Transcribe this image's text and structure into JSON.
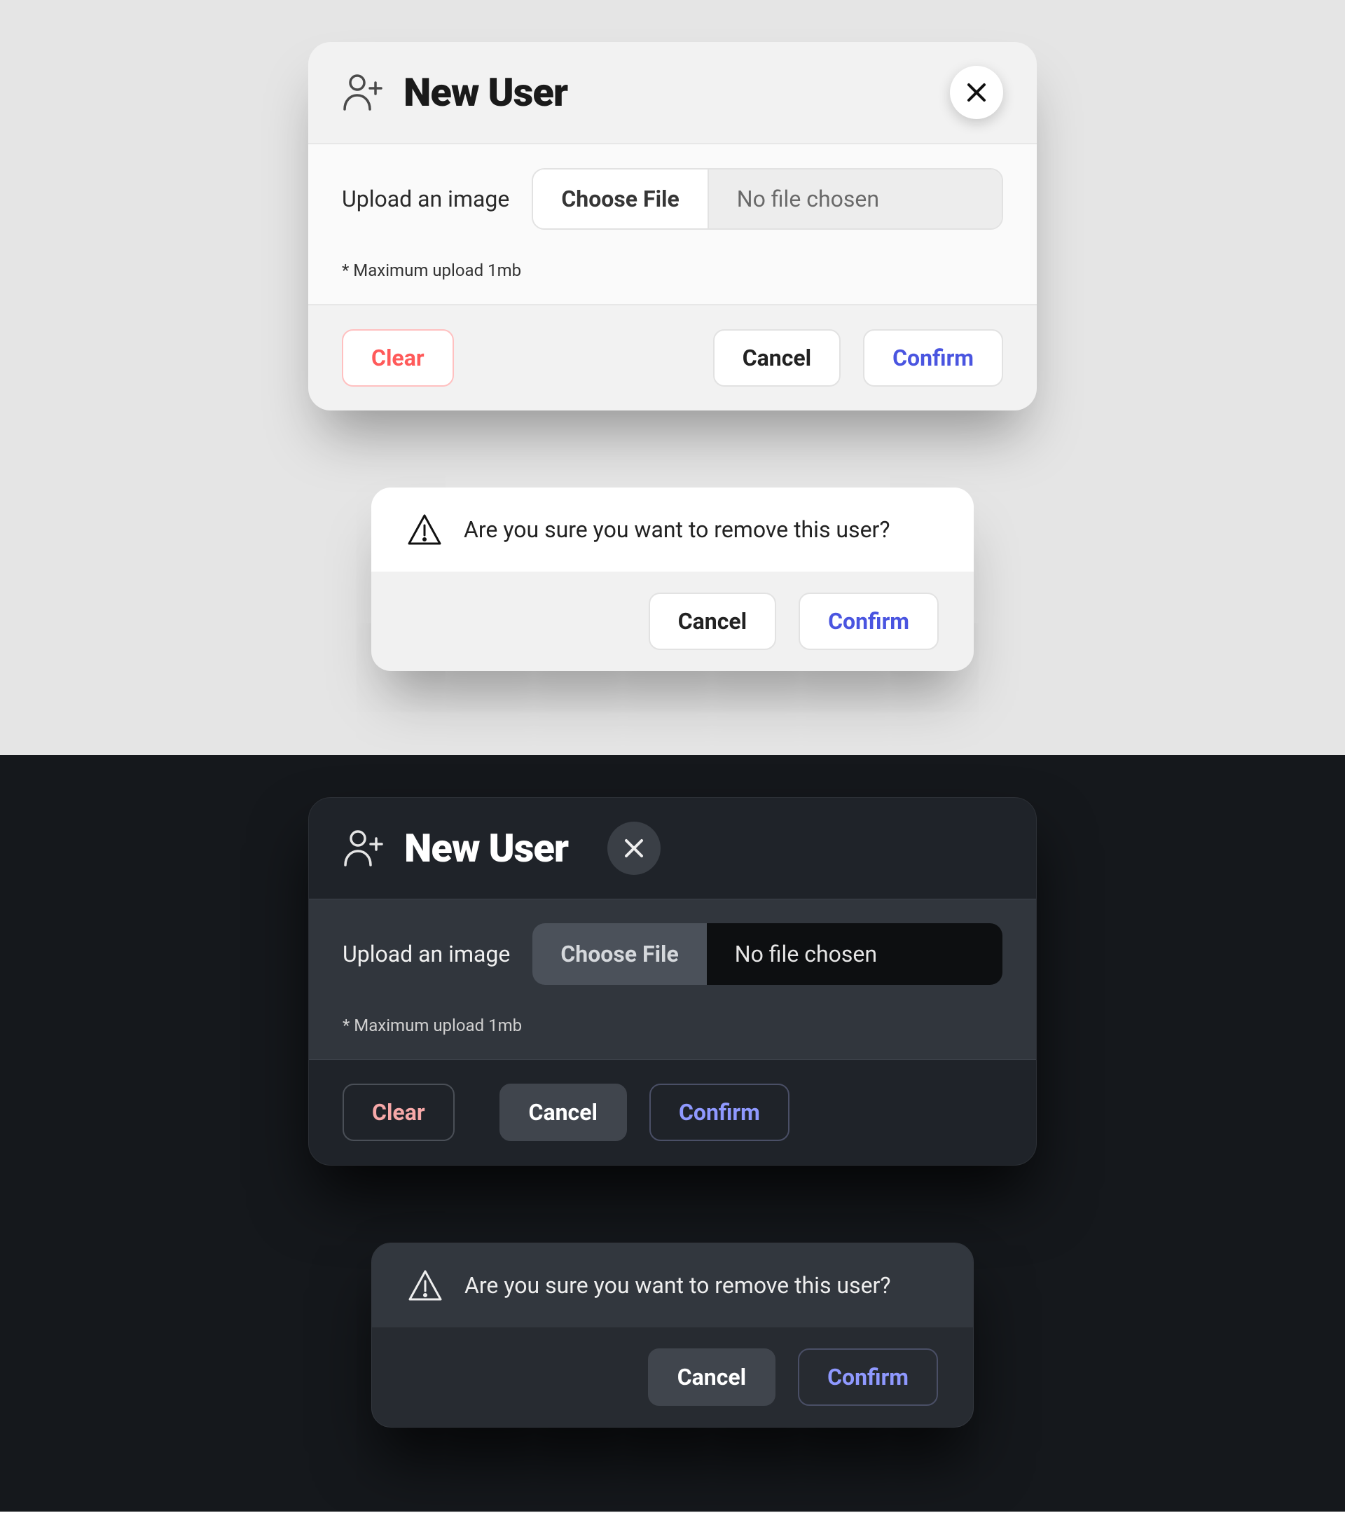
{
  "newUser": {
    "title": "New User",
    "uploadLabel": "Upload an image",
    "chooseFile": "Choose File",
    "noFile": "No file chosen",
    "hint": "* Maximum upload 1mb",
    "clear": "Clear",
    "cancel": "Cancel",
    "confirm": "Confirm"
  },
  "removeConfirm": {
    "message": "Are you sure you want to remove this user?",
    "cancel": "Cancel",
    "confirm": "Confirm"
  },
  "colors": {
    "accentLight": "#4a55e0",
    "dangerLight": "#ff5a5a",
    "accentDark": "#8f99ff",
    "dangerDark": "#f6a8a8"
  }
}
